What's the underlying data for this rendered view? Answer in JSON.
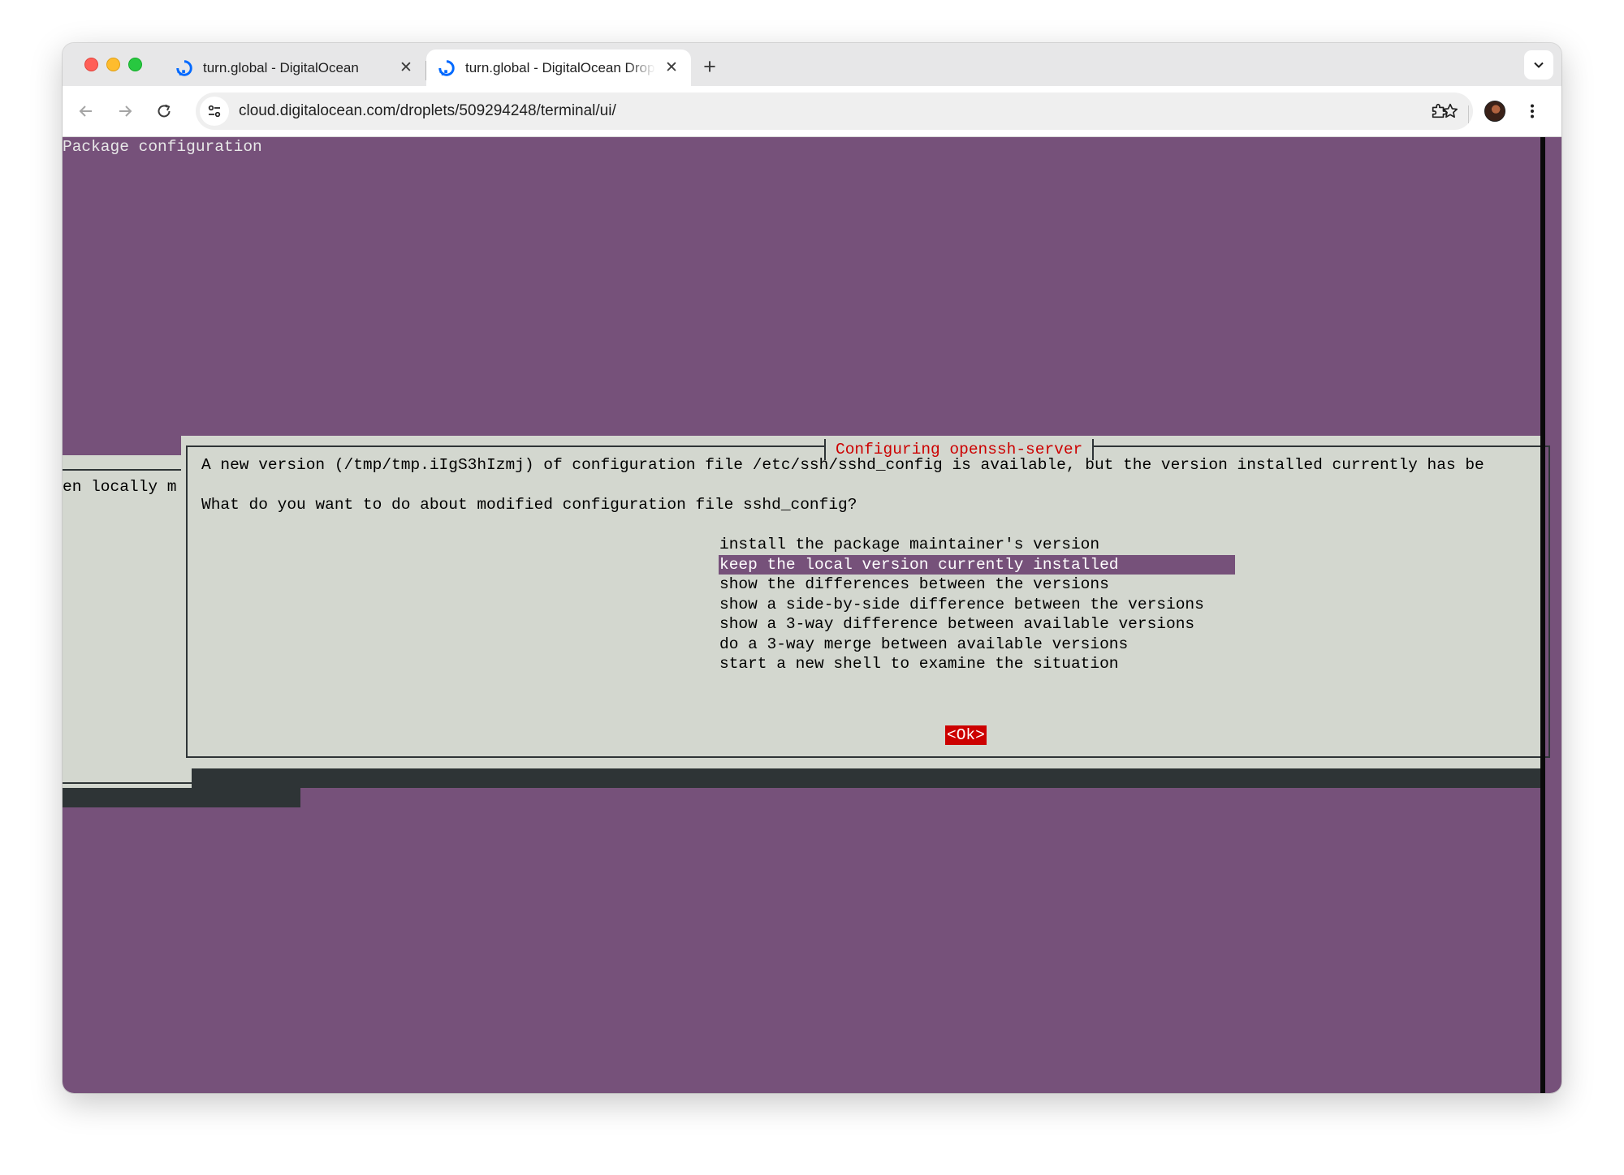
{
  "browser": {
    "tabs": [
      {
        "title": "turn.global - DigitalOcean",
        "active": false,
        "favicon": "digitalocean-logo-icon",
        "close": "✕"
      },
      {
        "title": "turn.global - DigitalOcean Droplets",
        "active": true,
        "favicon": "digitalocean-logo-icon",
        "close": "✕"
      }
    ],
    "new_tab": "+",
    "url": "cloud.digitalocean.com/droplets/509294248/terminal/ui/"
  },
  "terminal": {
    "header": "Package configuration",
    "background_dialog_fragment": "en locally m",
    "dialog": {
      "title": "Configuring openssh-server",
      "message_line1": "A new version (/tmp/tmp.iIgS3hIzmj) of configuration file /etc/ssh/sshd_config is available, but the version installed currently has be",
      "message_line2": "What do you want to do about modified configuration file sshd_config?",
      "options": [
        "install the package maintainer's version",
        "keep the local version currently installed",
        "show the differences between the versions",
        "show a side-by-side difference between the versions",
        "show a 3-way difference between available versions",
        "do a 3-way merge between available versions",
        "start a new shell to examine the situation"
      ],
      "selected_option": "keep the local version currently installed",
      "ok_label": "<Ok>"
    }
  },
  "colors": {
    "terminal_background": "#76517a",
    "dialog_background": "#d3d7cf",
    "title_red": "#cc0000",
    "selection": "#76517a",
    "shadow": "#2e3436"
  }
}
